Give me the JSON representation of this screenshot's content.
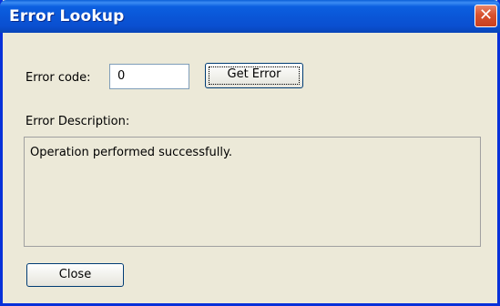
{
  "window": {
    "title": "Error Lookup",
    "close_glyph": "✕"
  },
  "form": {
    "error_code_label": "Error code:",
    "error_code_value": "0",
    "get_error_label": "Get Error",
    "description_label": "Error Description:",
    "description_text": "Operation performed successfully.",
    "close_label": "Close"
  },
  "icons": {
    "title_close": "close-icon"
  },
  "colors": {
    "titlebar": "#0a55d6",
    "dialog_bg": "#ece9d8",
    "close_button": "#d8522f",
    "input_border": "#7f9db9"
  }
}
